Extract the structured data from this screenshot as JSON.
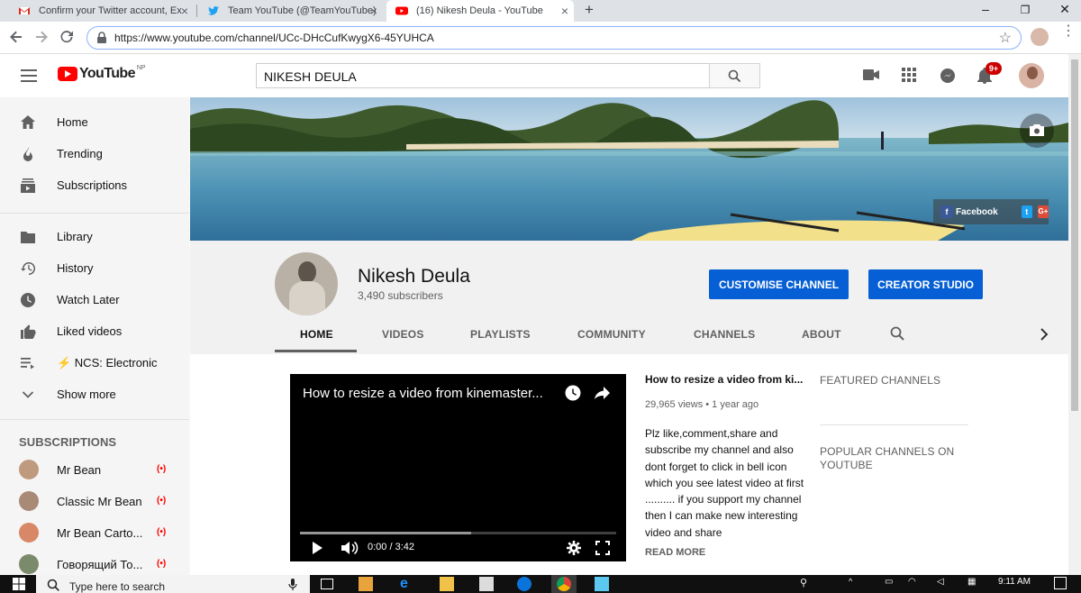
{
  "browser": {
    "tabs": [
      {
        "title": "Confirm your Twitter account, Ex",
        "icon": "gmail-icon"
      },
      {
        "title": "Team YouTube (@TeamYouTube)",
        "icon": "twitter-icon"
      },
      {
        "title": "(16) Nikesh Deula - YouTube",
        "icon": "youtube-icon",
        "active": true
      }
    ],
    "url": "https://www.youtube.com/channel/UCc-DHcCufKwygX6-45YUHCA"
  },
  "youtube": {
    "logo_text": "YouTube",
    "country_code": "NP",
    "search_value": "NIKESH DEULA",
    "notification_count": "9+"
  },
  "sidebar": {
    "main": [
      {
        "label": "Home",
        "icon": "home-icon"
      },
      {
        "label": "Trending",
        "icon": "trending-icon"
      },
      {
        "label": "Subscriptions",
        "icon": "subscriptions-icon"
      }
    ],
    "library": [
      {
        "label": "Library",
        "icon": "library-icon"
      },
      {
        "label": "History",
        "icon": "history-icon"
      },
      {
        "label": "Watch Later",
        "icon": "watch-later-icon"
      },
      {
        "label": "Liked videos",
        "icon": "liked-icon"
      },
      {
        "label": "⚡ NCS: Electronic",
        "icon": "playlist-icon"
      },
      {
        "label": "Show more",
        "icon": "chevron-down-icon"
      }
    ],
    "subscriptions_heading": "SUBSCRIPTIONS",
    "subscriptions": [
      {
        "label": "Mr Bean",
        "live": "(•)"
      },
      {
        "label": "Classic Mr Bean",
        "live": "(•)"
      },
      {
        "label": "Mr Bean Carto...",
        "live": "(•)"
      },
      {
        "label": "Говорящий То...",
        "live": "(•)"
      }
    ]
  },
  "banner": {
    "facebook_label": "Facebook"
  },
  "channel": {
    "name": "Nikesh Deula",
    "subscribers": "3,490 subscribers",
    "customise_label": "CUSTOMISE CHANNEL",
    "studio_label": "CREATOR STUDIO",
    "tabs": [
      "HOME",
      "VIDEOS",
      "PLAYLISTS",
      "COMMUNITY",
      "CHANNELS",
      "ABOUT"
    ],
    "active_tab": "HOME"
  },
  "video": {
    "player_title": "How to resize a video from kinemaster...",
    "time": "0:00 / 3:42",
    "progress_fraction": 0.0,
    "title": "How to resize a video from ki...",
    "meta": "29,965 views • 1 year ago",
    "description": "Plz like,comment,share and subscribe my channel and also dont forget to click in bell icon which you see latest video at first .......... if you support my channel then I can make new interesting video and share",
    "read_more": "READ MORE"
  },
  "right_column": {
    "featured": "FEATURED CHANNELS",
    "popular": "POPULAR CHANNELS ON YOUTUBE"
  },
  "taskbar": {
    "search_placeholder": "Type here to search",
    "time": "9:11 AM"
  },
  "colors": {
    "youtube_red": "#ff0000",
    "button_blue": "#065fd4",
    "sidebar_bg": "#f5f5f5"
  }
}
